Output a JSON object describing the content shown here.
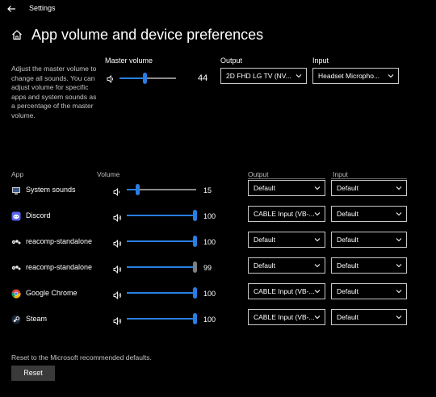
{
  "window": {
    "title": "Settings"
  },
  "page": {
    "title": "App volume and device preferences",
    "description": "Adjust the master volume to change all sounds. You can adjust volume for specific apps and system sounds as a percentage of the master volume."
  },
  "master": {
    "label": "Master volume",
    "value": 44,
    "value_text": "44",
    "output_label": "Output",
    "output_value": "2D FHD LG TV (NV...",
    "input_label": "Input",
    "input_value": "Headset Micropho..."
  },
  "headers": {
    "app": "App",
    "volume": "Volume",
    "output": "Output",
    "input": "Input"
  },
  "apps": [
    {
      "name": "System sounds",
      "icon": "system-sounds-icon",
      "volume": 15,
      "volume_text": "15",
      "output": "Default",
      "input": "Default"
    },
    {
      "name": "Discord",
      "icon": "discord-icon",
      "volume": 100,
      "volume_text": "100",
      "output": "CABLE Input (VB-...",
      "input": "Default"
    },
    {
      "name": "reacomp-standalone",
      "icon": "reacomp-icon",
      "volume": 100,
      "volume_text": "100",
      "output": "Default",
      "input": "Default"
    },
    {
      "name": "reacomp-standalone",
      "icon": "reacomp-icon",
      "volume": 99,
      "volume_text": "99",
      "output": "Default",
      "input": "Default"
    },
    {
      "name": "Google Chrome",
      "icon": "chrome-icon",
      "volume": 100,
      "volume_text": "100",
      "output": "CABLE Input (VB-...",
      "input": "Default"
    },
    {
      "name": "Steam",
      "icon": "steam-icon",
      "volume": 100,
      "volume_text": "100",
      "output": "CABLE Input (VB-...",
      "input": "Default"
    }
  ],
  "footer": {
    "reset_text": "Reset to the Microsoft recommended defaults.",
    "reset_button": "Reset"
  },
  "colors": {
    "accent": "#2a7de1",
    "background": "#000000"
  }
}
